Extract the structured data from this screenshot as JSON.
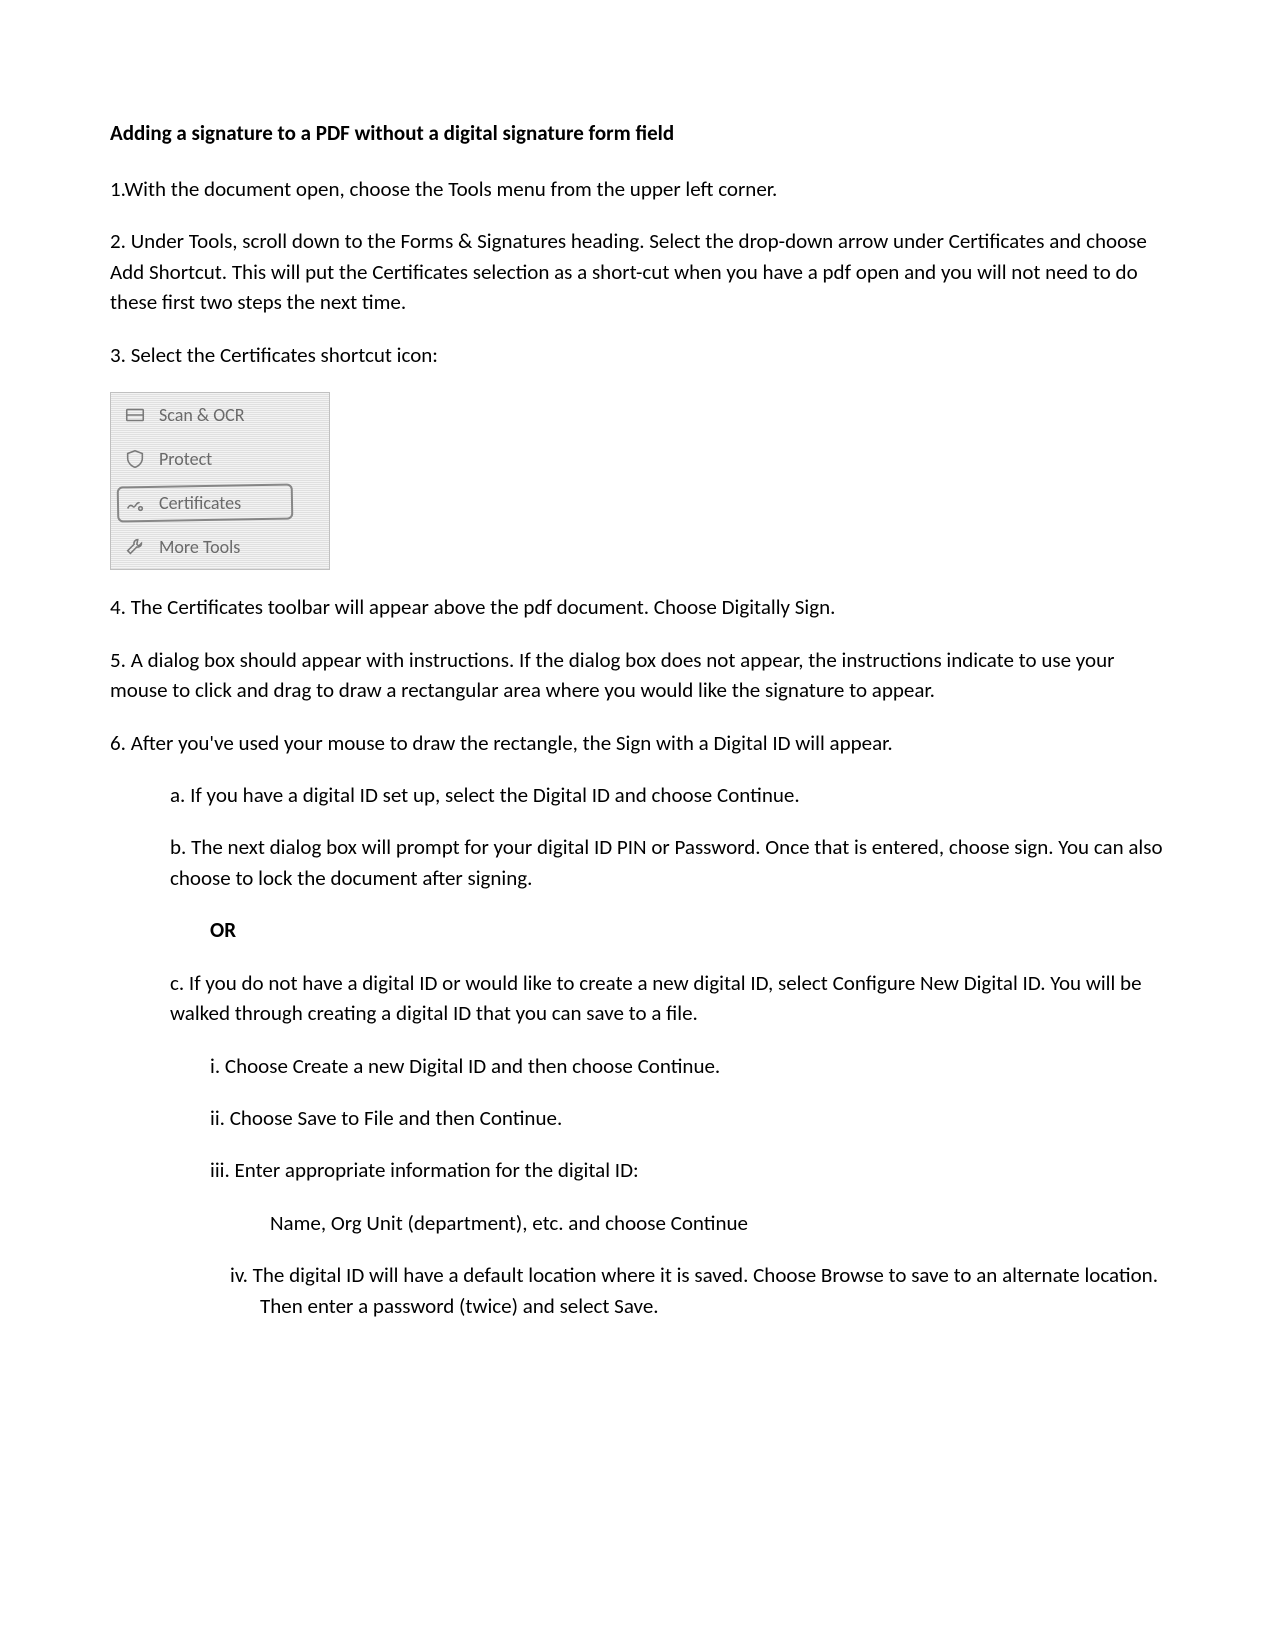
{
  "title": "Adding a signature to a PDF without a digital signature form field",
  "steps": {
    "s1": "1.With the document open, choose the Tools menu from the upper left corner.",
    "s2": "2. Under Tools, scroll down to the Forms & Signatures heading. Select the drop-down arrow under Certificates and choose Add Shortcut. This will put the Certificates selection as a short-cut when you have a pdf open and you will not need to do these first two steps the next time.",
    "s3": "3. Select the Certificates shortcut icon:",
    "s4": "4. The Certificates toolbar will appear above the pdf document. Choose Digitally Sign.",
    "s5": "5. A dialog box should appear with instructions. If the dialog box does not appear, the instructions indicate to use your mouse to click and drag to draw a rectangular area where you would like the signature to appear.",
    "s6": "6. After you've used your mouse to draw the rectangle, the Sign with a Digital ID will appear.",
    "s6a": "a. If you have a digital ID set up, select the Digital ID and choose Continue.",
    "s6b": "b. The next dialog box will prompt for your digital ID PIN or Password. Once that is entered, choose sign. You can also choose to lock the document after signing.",
    "or": "OR",
    "s6c": "c. If you do not have a digital ID or would like to create a new digital ID, select Configure New Digital ID. You will be walked through creating a digital ID that you can save to a file.",
    "s6c_i": "i. Choose Create a new Digital ID and then choose Continue.",
    "s6c_ii": "ii. Choose Save to File and then Continue.",
    "s6c_iii": "iii. Enter appropriate information for the digital ID:",
    "s6c_iii_detail": "Name, Org Unit (department), etc. and choose Continue",
    "s6c_iv": "iv. The digital ID will have a default location where it is saved. Choose Browse to save to an alternate location. Then enter a password (twice) and select Save."
  },
  "toolbar": {
    "scan_ocr": "Scan & OCR",
    "protect": "Protect",
    "certificates": "Certificates",
    "more_tools": "More Tools"
  }
}
